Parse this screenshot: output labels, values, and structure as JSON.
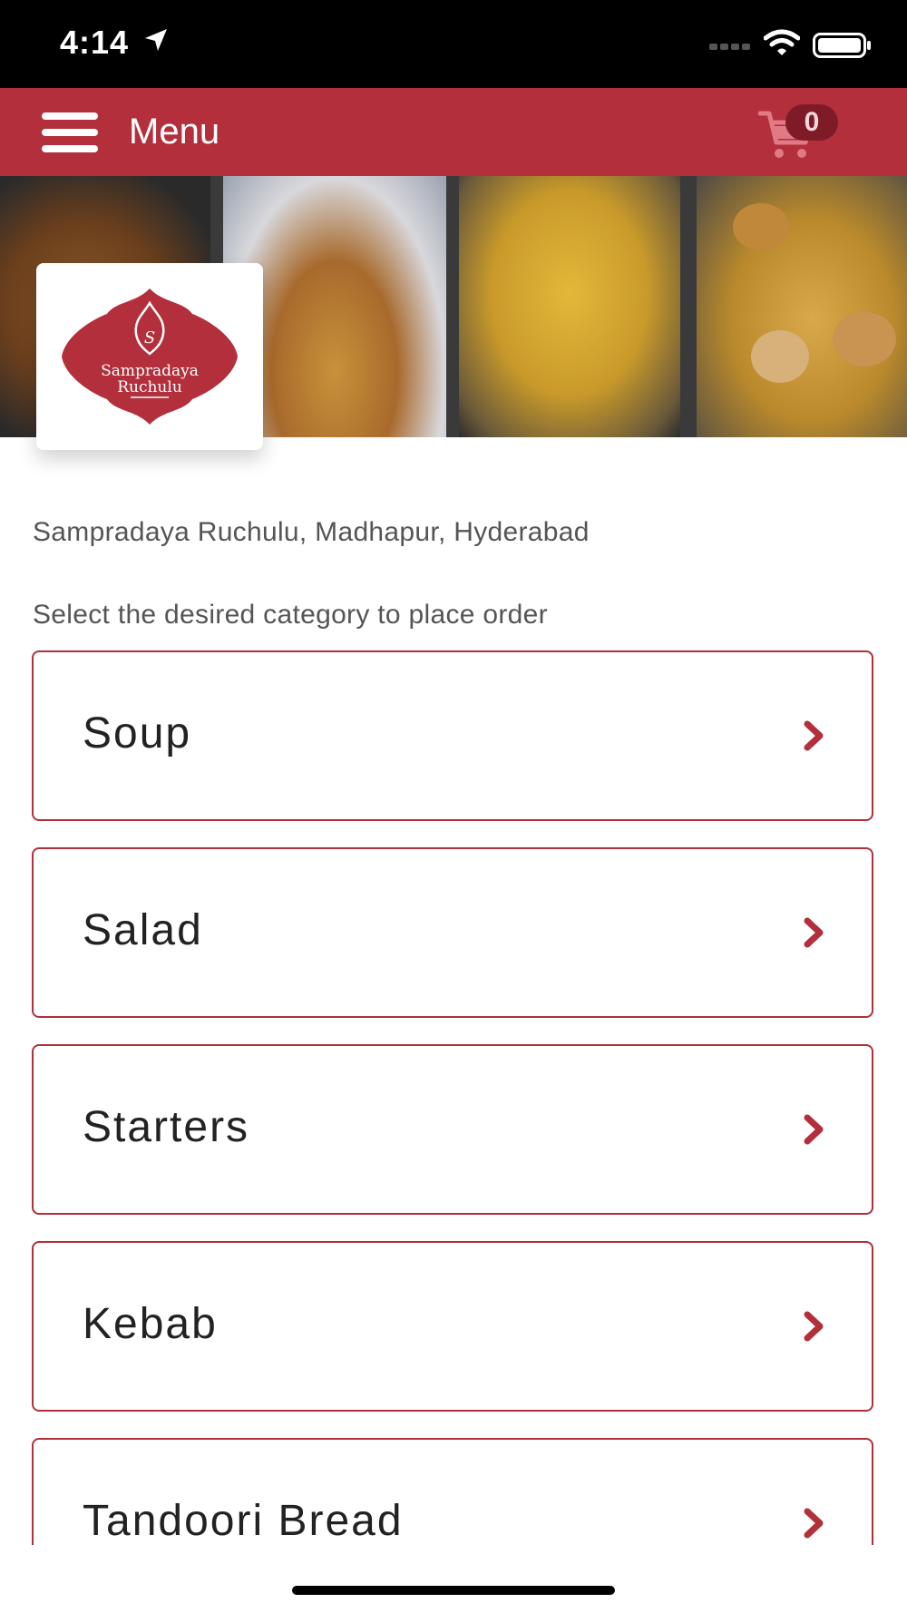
{
  "status_bar": {
    "time": "4:14",
    "icons": [
      "location-arrow-icon",
      "signal-icon",
      "wifi-icon",
      "battery-icon"
    ]
  },
  "header": {
    "title": "Menu",
    "cart_count": "0",
    "icons": [
      "hamburger-menu-icon",
      "cart-icon"
    ]
  },
  "banner": {
    "logo_text_line1": "Sampradaya",
    "logo_text_line2": "Ruchulu"
  },
  "restaurant": {
    "name": "Sampradaya Ruchulu, Madhapur, Hyderabad"
  },
  "instruction": "Select the desired category to place order",
  "categories": [
    {
      "label": "Soup"
    },
    {
      "label": "Salad"
    },
    {
      "label": "Starters"
    },
    {
      "label": "Kebab"
    },
    {
      "label": "Tandoori Bread"
    }
  ],
  "colors": {
    "brand": "#b22f3b",
    "badge": "#7e1b26",
    "text": "#222222",
    "muted_text": "#555555"
  }
}
